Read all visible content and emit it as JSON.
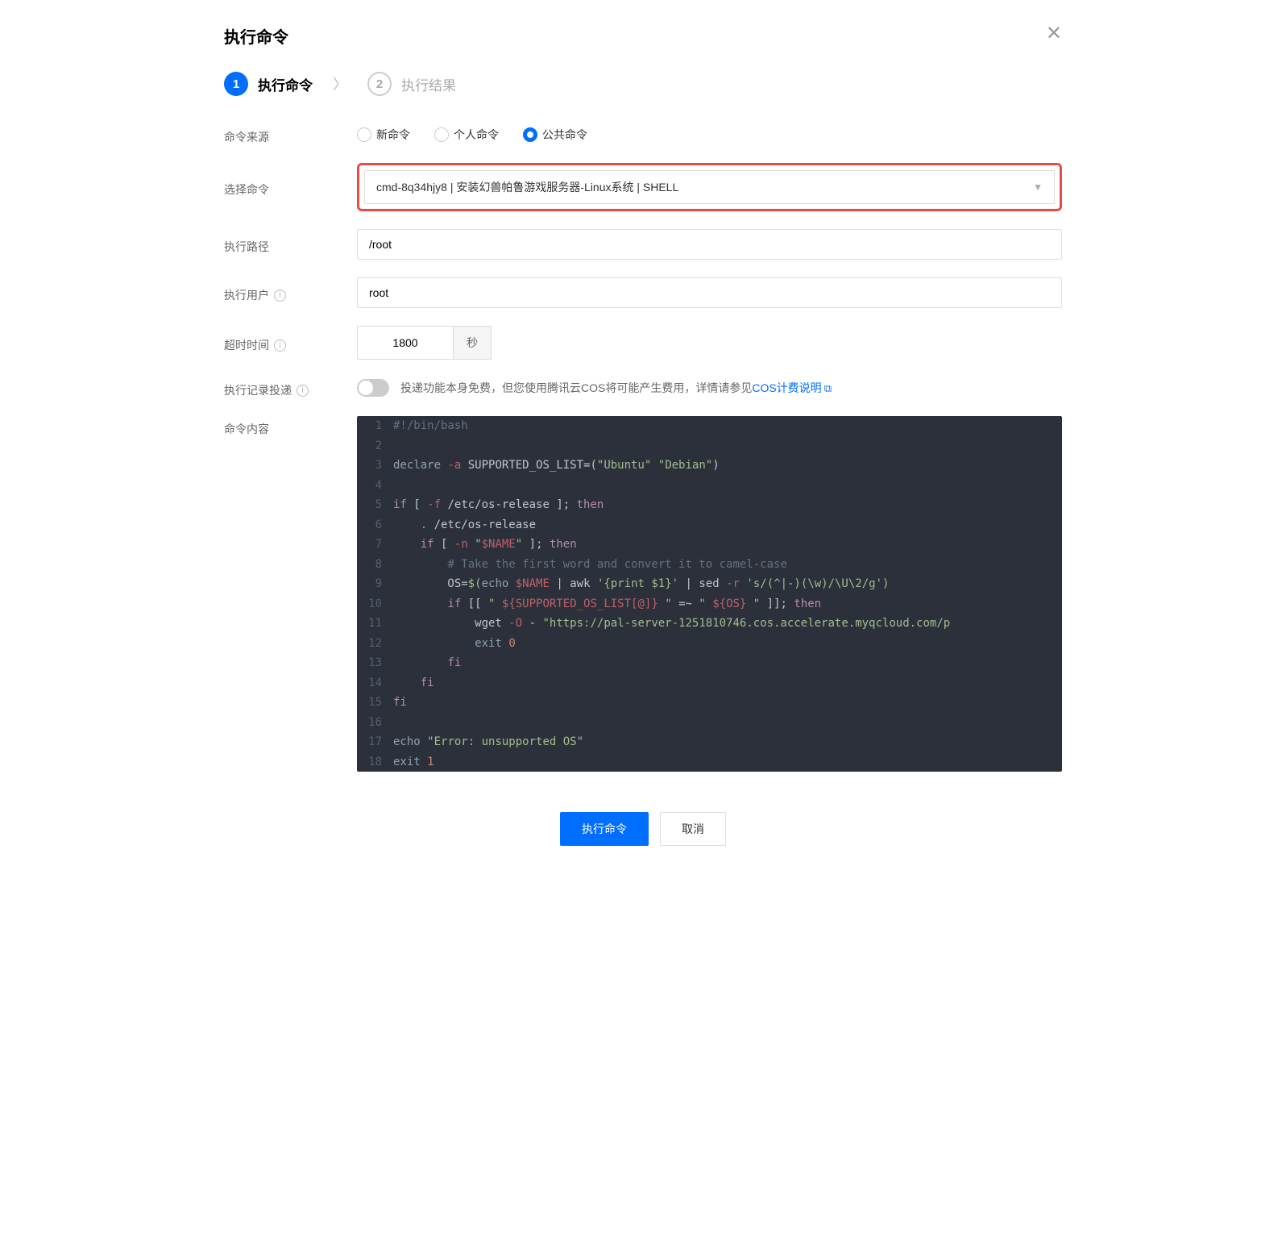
{
  "modal": {
    "title": "执行命令",
    "steps": [
      {
        "num": "1",
        "label": "执行命令",
        "state": "active"
      },
      {
        "num": "2",
        "label": "执行结果",
        "state": "inactive"
      }
    ]
  },
  "form": {
    "source": {
      "label": "命令来源",
      "options": [
        {
          "label": "新命令",
          "selected": false
        },
        {
          "label": "个人命令",
          "selected": false
        },
        {
          "label": "公共命令",
          "selected": true
        }
      ]
    },
    "select_command": {
      "label": "选择命令",
      "value": "cmd-8q34hjy8 | 安装幻兽帕鲁游戏服务器-Linux系统 | SHELL"
    },
    "exec_path": {
      "label": "执行路径",
      "value": "/root"
    },
    "exec_user": {
      "label": "执行用户",
      "value": "root"
    },
    "timeout": {
      "label": "超时时间",
      "value": "1800",
      "unit": "秒"
    },
    "delivery": {
      "label": "执行记录投递",
      "hint_before": "投递功能本身免费，但您使用腾讯云COS将可能产生费用，详情请参见",
      "link_text": "COS计费说明"
    },
    "content_label": "命令内容"
  },
  "code": {
    "lines": [
      {
        "n": "1",
        "html": "<span class='c-comment'>#!/bin/bash</span>"
      },
      {
        "n": "2",
        "html": ""
      },
      {
        "n": "3",
        "html": "<span class='c-builtin'>declare</span> <span class='c-flag'>-a</span> SUPPORTED_OS_LIST<span class='c-op'>=(</span><span class='c-string'>\"Ubuntu\"</span> <span class='c-string'>\"Debian\"</span><span class='c-op'>)</span>"
      },
      {
        "n": "4",
        "html": ""
      },
      {
        "n": "5",
        "html": "<span class='c-keyword'>if</span> <span class='c-op'>[</span> <span class='c-flag'>-f</span> /etc/os-release <span class='c-op'>]</span>; <span class='c-keyword'>then</span>"
      },
      {
        "n": "6",
        "html": "    <span class='c-builtin'>.</span> /etc/os-release"
      },
      {
        "n": "7",
        "html": "    <span class='c-keyword'>if</span> <span class='c-op'>[</span> <span class='c-flag'>-n</span> <span class='c-string'>\"</span><span class='c-var'>$NAME</span><span class='c-string'>\"</span> <span class='c-op'>]</span>; <span class='c-keyword'>then</span>"
      },
      {
        "n": "8",
        "html": "        <span class='c-comment'># Take the first word and convert it to camel-case</span>"
      },
      {
        "n": "9",
        "html": "        OS<span class='c-op'>=</span><span class='c-string'>$(</span><span class='c-builtin'>echo</span> <span class='c-var'>$NAME</span> <span class='c-op'>|</span> awk <span class='c-string'>'{print $1}'</span> <span class='c-op'>|</span> sed <span class='c-flag'>-r</span> <span class='c-string'>'s/(^|-)(\\w)/\\U\\2/g'</span><span class='c-string'>)</span>"
      },
      {
        "n": "10",
        "html": "        <span class='c-keyword'>if</span> <span class='c-op'>[[</span> <span class='c-string'>\" </span><span class='c-var'>${SUPPORTED_OS_LIST[@]}</span><span class='c-string'> \"</span> <span class='c-op'>=~</span> <span class='c-string'>\" </span><span class='c-var'>${OS}</span><span class='c-string'> \"</span> <span class='c-op'>]]</span>; <span class='c-keyword'>then</span>"
      },
      {
        "n": "11",
        "html": "            wget <span class='c-flag'>-O</span> <span class='c-op'>-</span> <span class='c-string'>\"https://pal-server-1251810746.cos.accelerate.myqcloud.com/p</span>"
      },
      {
        "n": "12",
        "html": "            <span class='c-builtin'>exit</span> <span class='c-num'>0</span>"
      },
      {
        "n": "13",
        "html": "        <span class='c-keyword'>fi</span>"
      },
      {
        "n": "14",
        "html": "    <span class='c-keyword'>fi</span>"
      },
      {
        "n": "15",
        "html": "<span class='c-keyword'>fi</span>"
      },
      {
        "n": "16",
        "html": ""
      },
      {
        "n": "17",
        "html": "<span class='c-builtin'>echo</span> <span class='c-string'>\"Error: unsupported OS\"</span>"
      },
      {
        "n": "18",
        "html": "<span class='c-builtin'>exit</span> <span class='c-num'>1</span>"
      }
    ]
  },
  "footer": {
    "primary": "执行命令",
    "cancel": "取消"
  }
}
